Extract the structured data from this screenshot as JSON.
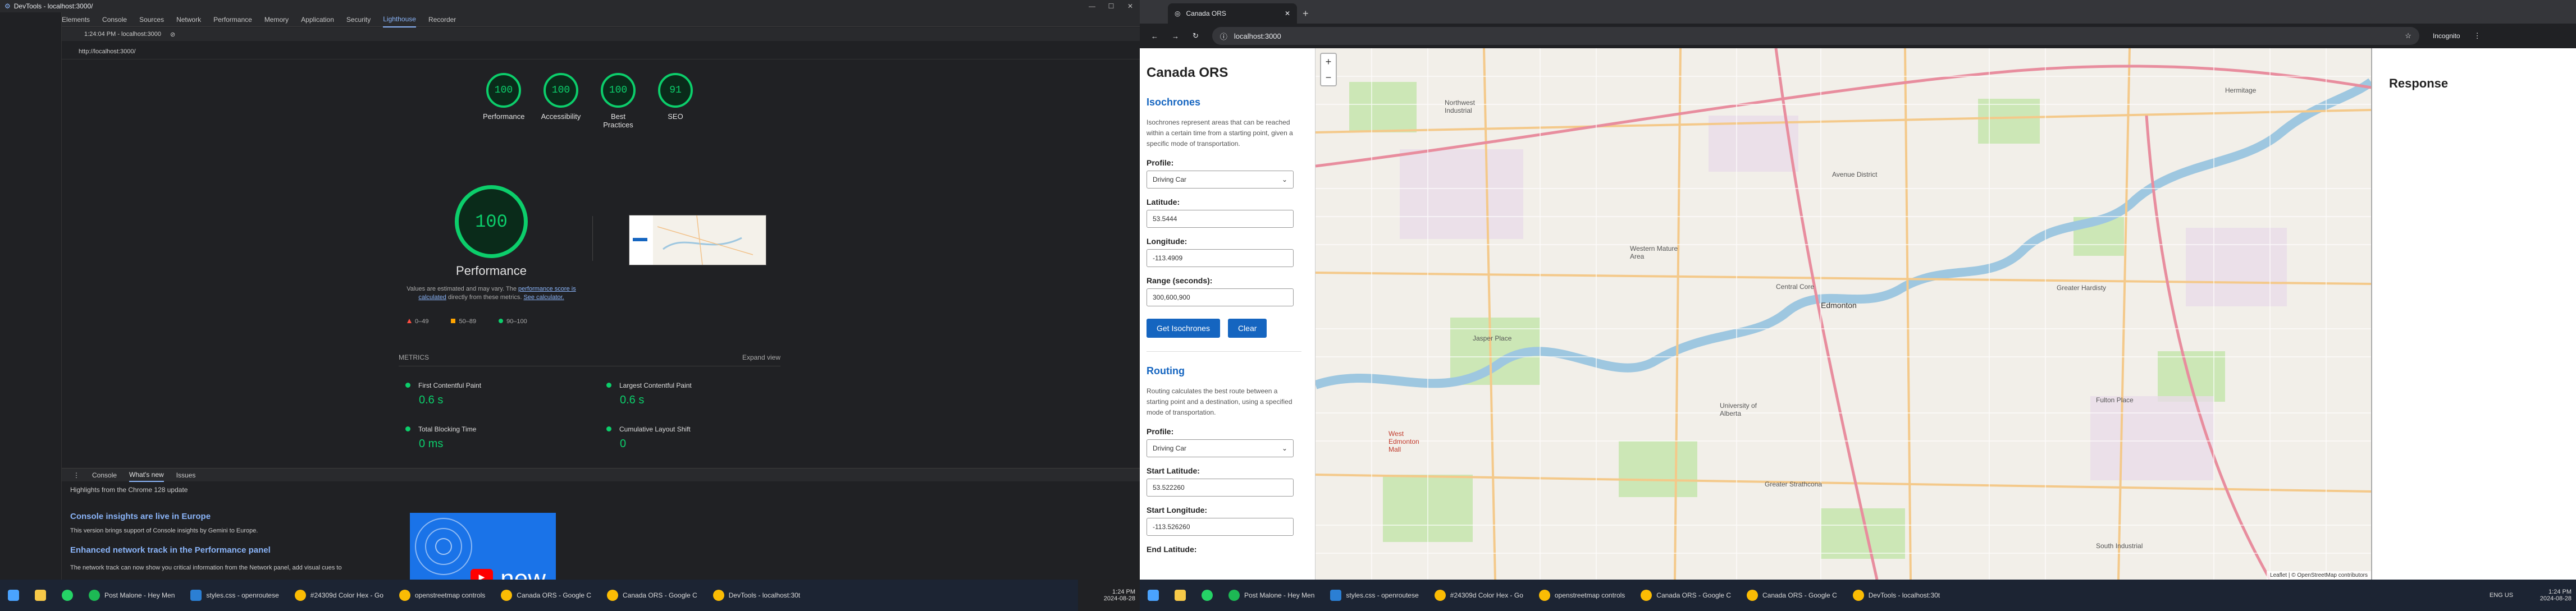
{
  "left": {
    "window_title": "DevTools - localhost:3000/",
    "tabs": [
      "Elements",
      "Console",
      "Sources",
      "Network",
      "Performance",
      "Memory",
      "Application",
      "Security",
      "Lighthouse",
      "Recorder"
    ],
    "active_tab": "Lighthouse",
    "report_selector": "1:24:04 PM - localhost:3000",
    "url": "http://localhost:3000/",
    "scores": [
      {
        "label": "Performance",
        "value": "100"
      },
      {
        "label": "Accessibility",
        "value": "100"
      },
      {
        "label": "Best Practices",
        "value": "100"
      },
      {
        "label": "SEO",
        "value": "91"
      }
    ],
    "perf_score": "100",
    "perf_title": "Performance",
    "perf_note_pre": "Values are estimated and may vary. The ",
    "perf_note_link": "performance score is calculated",
    "perf_note_mid": " directly from these metrics. ",
    "perf_note_link2": "See calculator.",
    "legend": [
      "0–49",
      "50–89",
      "90–100"
    ],
    "metrics_label": "METRICS",
    "expand_view": "Expand view",
    "metrics": [
      {
        "name": "First Contentful Paint",
        "value": "0.6 s"
      },
      {
        "name": "Largest Contentful Paint",
        "value": "0.6 s"
      },
      {
        "name": "Total Blocking Time",
        "value": "0 ms"
      },
      {
        "name": "Cumulative Layout Shift",
        "value": "0"
      }
    ],
    "drawer_tabs": [
      "Console",
      "What's new",
      "Issues"
    ],
    "drawer_active": "What's new",
    "highlights": "Highlights from the Chrome 128 update",
    "news1_title": "Console insights are live in Europe",
    "news1_text": "This version brings support of Console insights by Gemini to Europe.",
    "news2_title": "Enhanced network track in the Performance panel",
    "news2_text": "The network track can now show you critical information from the Network panel, add visual cues to",
    "promo_text": "new",
    "taskbar": [
      {
        "label": "Post Malone - Hey Men",
        "color": "#1db954"
      },
      {
        "label": "styles.css - openroutese",
        "color": "#2b7fd4"
      },
      {
        "label": "#24309d Color Hex - Go",
        "color": "#fbbc04"
      },
      {
        "label": "openstreetmap controls",
        "color": "#fbbc04"
      },
      {
        "label": "Canada ORS - Google C",
        "color": "#fbbc04"
      },
      {
        "label": "Canada ORS - Google C",
        "color": "#fbbc04"
      },
      {
        "label": "DevTools - localhost:30t",
        "color": "#fbbc04"
      }
    ],
    "clock_time": "1:24 PM",
    "clock_date": "2024-08-28"
  },
  "right": {
    "tab_title": "Canada ORS",
    "url": "localhost:3000",
    "incognito": "Incognito",
    "app_title": "Canada ORS",
    "iso_heading": "Isochrones",
    "iso_desc": "Isochrones represent areas that can be reached within a certain time from a starting point, given a specific mode of transportation.",
    "profile_label": "Profile:",
    "profile_value": "Driving Car",
    "lat_label": "Latitude:",
    "lat_value": "53.5444",
    "lon_label": "Longitude:",
    "lon_value": "-113.4909",
    "range_label": "Range (seconds):",
    "range_value": "300,600,900",
    "get_iso": "Get Isochrones",
    "clear": "Clear",
    "routing_heading": "Routing",
    "routing_desc": "Routing calculates the best route between a starting point and a destination, using a specified mode of transportation.",
    "r_profile_label": "Profile:",
    "r_profile_value": "Driving Car",
    "start_lat_label": "Start Latitude:",
    "start_lat_value": "53.522260",
    "start_lon_label": "Start Longitude:",
    "start_lon_value": "-113.526260",
    "end_lat_label": "End Latitude:",
    "response_title": "Response",
    "attribution": "Leaflet | © OpenStreetMap contributors",
    "map_labels": {
      "l1": "Northwest Industrial",
      "l2": "Hermitage",
      "l3": "Edmonton",
      "l4": "Central Core",
      "l5": "Western Mature Area",
      "l6": "Greater Hardisty",
      "l7": "Jasper Place",
      "l8": "Greater Strathcona",
      "l9": "South Industrial",
      "l10": "West Edmonton Mall",
      "l11": "Fulton Place",
      "l12": "Avenue District",
      "l13": "University of Alberta"
    },
    "taskbar": [
      {
        "label": "Post Malone - Hey Men",
        "color": "#1db954"
      },
      {
        "label": "styles.css - openroutese",
        "color": "#2b7fd4"
      },
      {
        "label": "#24309d Color Hex - Go",
        "color": "#fbbc04"
      },
      {
        "label": "openstreetmap controls",
        "color": "#fbbc04"
      },
      {
        "label": "Canada ORS - Google C",
        "color": "#fbbc04"
      },
      {
        "label": "Canada ORS - Google C",
        "color": "#fbbc04"
      },
      {
        "label": "DevTools - localhost:30t",
        "color": "#fbbc04"
      }
    ],
    "tray_lang": "ENG US",
    "clock_time": "1:24 PM",
    "clock_date": "2024-08-28"
  },
  "colors": {
    "pass": "#0cce6b",
    "accent": "#8ab4f8",
    "button": "#1565c0"
  }
}
